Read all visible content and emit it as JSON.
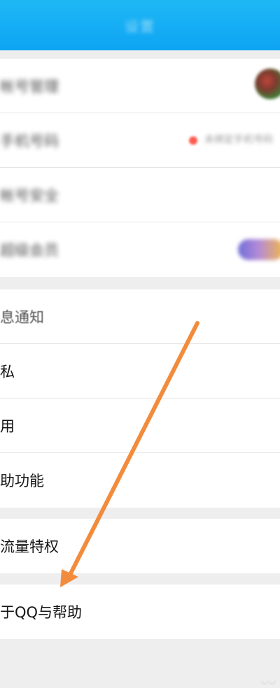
{
  "header": {
    "title": "设置"
  },
  "account_group": {
    "items": [
      {
        "label": "帐号管理"
      },
      {
        "label": "手机号码",
        "status_text": "未绑定手机号码"
      },
      {
        "label": "帐号安全"
      },
      {
        "label": "超级会员"
      }
    ]
  },
  "settings_group": {
    "items": [
      {
        "label": "息通知"
      },
      {
        "label": "私"
      },
      {
        "label": "用"
      },
      {
        "label": "助功能"
      }
    ]
  },
  "traffic_group": {
    "items": [
      {
        "label": "流量特权"
      }
    ]
  },
  "about_group": {
    "items": [
      {
        "label": "于QQ与帮助"
      }
    ]
  },
  "colors": {
    "header_blue": "#0ea4f3",
    "annotation_arrow": "#f28c3c",
    "status_dot": "#ff5a4f"
  },
  "icons": [
    "avatar",
    "status-dot",
    "vip-badge-icon",
    "annotation-arrow"
  ]
}
